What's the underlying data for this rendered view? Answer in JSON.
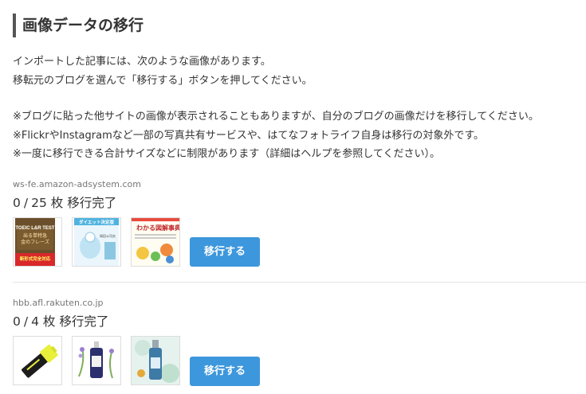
{
  "title": "画像データの移行",
  "intro_lines": [
    "インポートした記事には、次のような画像があります。",
    "移転元のブログを選んで「移行する」ボタンを押してください。"
  ],
  "note_lines": [
    "※ブログに貼った他サイトの画像が表示されることもありますが、自分のブログの画像だけを移行してください。",
    "※FlickrやInstagramなど一部の写真共有サービスや、はてなフォトライフ自身は移行の対象外です。",
    "※一度に移行できる合計サイズなどに制限があります（詳細はヘルプを参照してください）。"
  ],
  "sources": [
    {
      "domain": "ws-fe.amazon-adsystem.com",
      "migrated": "0",
      "total": "25",
      "count_suffix": "枚 移行完了",
      "button_label": "移行する",
      "thumbnails": [
        {
          "name": "toeic-book-thumbnail",
          "texts": [
            "TOEIC L&R TEST",
            "出る単特急",
            "金のフレーズ",
            "新形式完全対応"
          ]
        },
        {
          "name": "diet-book-thumbnail",
          "texts": [
            "ダイエット決定版",
            "岡田斗司夫"
          ]
        },
        {
          "name": "illustrated-dictionary-thumbnail",
          "texts": [
            "わかる図解事典"
          ]
        }
      ]
    },
    {
      "domain": "hbb.afl.rakuten.co.jp",
      "migrated": "0",
      "total": "4",
      "count_suffix": "枚 移行完了",
      "button_label": "移行する",
      "thumbnails": [
        {
          "name": "highlighter-product-thumbnail",
          "texts": []
        },
        {
          "name": "lavender-spray-thumbnail",
          "texts": []
        },
        {
          "name": "mist-bottle-thumbnail",
          "texts": []
        }
      ]
    }
  ],
  "colors": {
    "accent_button": "#3d97dc",
    "title_bar": "#555555",
    "divider": "#e3e3e3"
  }
}
